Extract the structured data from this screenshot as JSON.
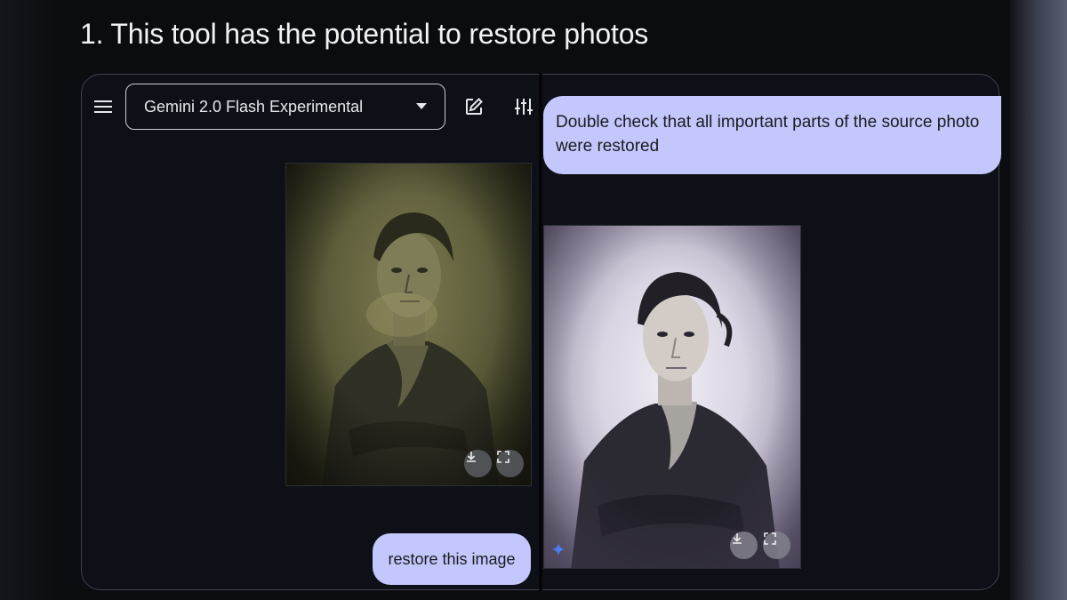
{
  "heading": "1. This tool has the potential to restore photos",
  "toolbar": {
    "model_label": "Gemini 2.0 Flash Experimental",
    "menu_icon": "hamburger-menu-icon",
    "new_chat_icon": "edit-icon",
    "settings_icon": "tune-sliders-icon"
  },
  "messages": {
    "top_prompt": "Double check that all important parts of the source photo were restored",
    "bottom_prompt": "restore this image"
  },
  "colors": {
    "bubble": "#c4c7fb",
    "frame_border": "#3e4150",
    "background": "#0b0c10"
  }
}
